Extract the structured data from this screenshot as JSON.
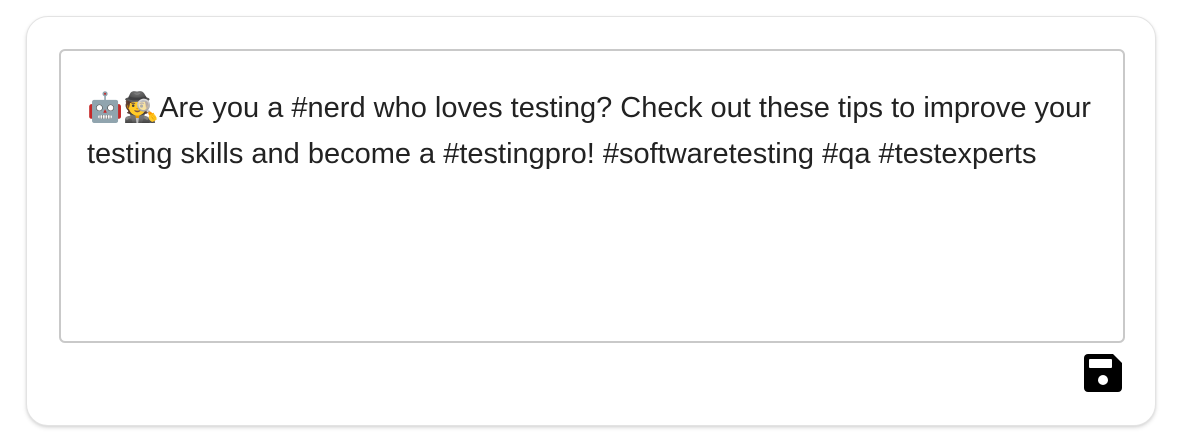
{
  "editor": {
    "content": "🤖🕵️Are you a #nerd who loves testing? Check out these tips to improve your testing skills and become a #testingpro! #softwaretesting #qa #testexperts"
  },
  "toolbar": {
    "save_icon": "save-icon",
    "icon_color": "#000000"
  }
}
